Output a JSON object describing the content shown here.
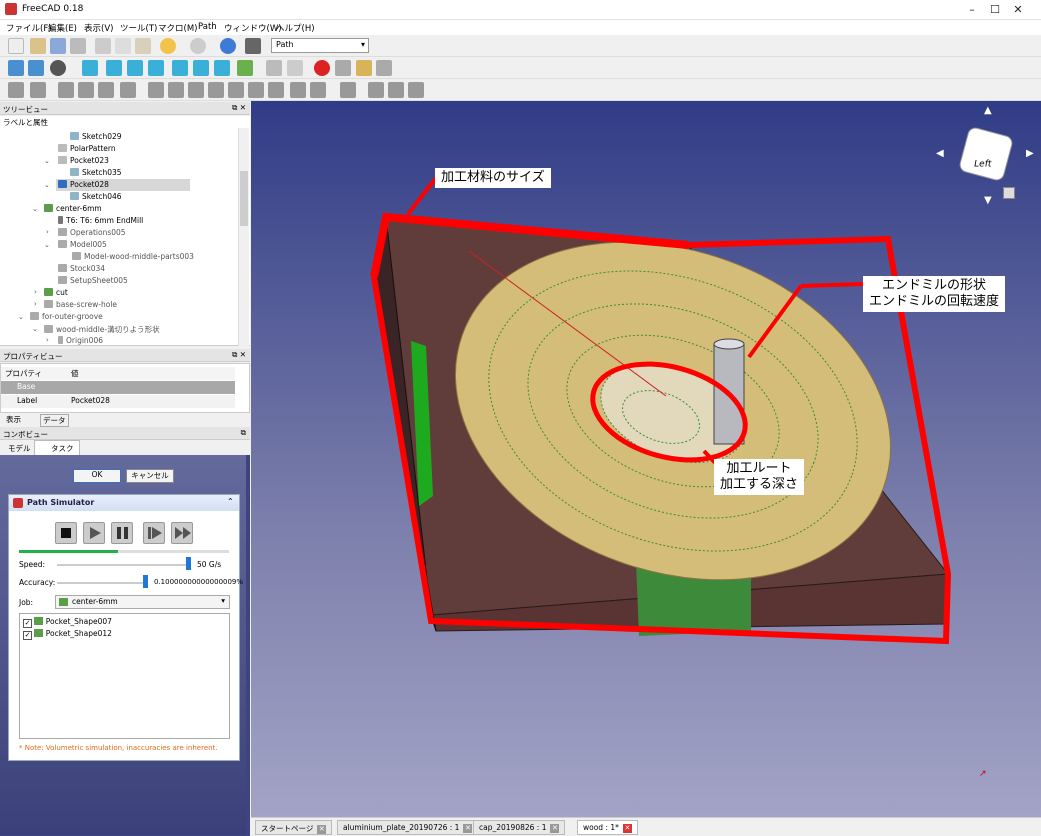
{
  "window": {
    "title": "FreeCAD 0.18",
    "controls": [
      "–",
      "☐",
      "✕"
    ]
  },
  "menu": [
    "ファイル(F)",
    "編集(E)",
    "表示(V)",
    "ツール(T)",
    "マクロ(M)",
    "Path",
    "ウィンドウ(W)",
    "ヘルプ(H)"
  ],
  "workbench": "Path",
  "tree_panel": {
    "title": "ツリービュー",
    "header": "ラベルと属性",
    "items": [
      {
        "label": "Sketch029",
        "depth": 5
      },
      {
        "label": "PolarPattern",
        "depth": 4
      },
      {
        "label": "Pocket023",
        "depth": 4
      },
      {
        "label": "Sketch035",
        "depth": 5
      },
      {
        "label": "Pocket028",
        "depth": 4
      },
      {
        "label": "Sketch046",
        "depth": 5
      },
      {
        "label": "center-6mm",
        "depth": 2
      },
      {
        "label": "T6: T6: 6mm EndMill",
        "depth": 3
      },
      {
        "label": "Operations005",
        "depth": 3
      },
      {
        "label": "Model005",
        "depth": 3
      },
      {
        "label": "Model-wood-middle-parts003",
        "depth": 4
      },
      {
        "label": "Stock034",
        "depth": 3
      },
      {
        "label": "SetupSheet005",
        "depth": 3
      },
      {
        "label": "cut",
        "depth": 2
      },
      {
        "label": "base-screw-hole",
        "depth": 2
      },
      {
        "label": "for-outer-groove",
        "depth": 1
      },
      {
        "label": "wood-middle-溝切りよう形状",
        "depth": 2
      },
      {
        "label": "Origin006",
        "depth": 3
      }
    ]
  },
  "property_panel": {
    "title": "プロパティビュー",
    "col1": "プロパティ",
    "col2": "値",
    "group": "Base",
    "rows": [
      {
        "name": "Label",
        "value": "Pocket028"
      }
    ],
    "tabs": [
      "表示",
      "データ"
    ]
  },
  "combo_panel": {
    "title": "コンボビュー",
    "tabs": [
      "モデル",
      "タスク"
    ],
    "ok": "OK",
    "cancel": "キャンセル"
  },
  "simulator": {
    "title": "Path Simulator",
    "progress": 0.47,
    "speed_label": "Speed:",
    "speed_value": "50 G/s",
    "accuracy_label": "Accuracy:",
    "accuracy_value": "0.10000000000000009%",
    "job_label": "Job:",
    "job_value": "center-6mm",
    "operations": [
      "Pocket_Shape007",
      "Pocket_Shape012"
    ],
    "note": "* Note: Volumetric simulation, inaccuracies are inherent."
  },
  "viewport": {
    "navcube_face": "Left",
    "annotations": {
      "stock": "加工材料のサイズ",
      "tool1": "エンドミルの形状",
      "tool2": "エンドミルの回転速度",
      "route1": "加工ルート",
      "route2": "加工する深さ"
    }
  },
  "doc_tabs": [
    "スタートページ",
    "aluminium_plate_20190726 : 1",
    "cap_20190826 : 1",
    "wood : 1*"
  ]
}
